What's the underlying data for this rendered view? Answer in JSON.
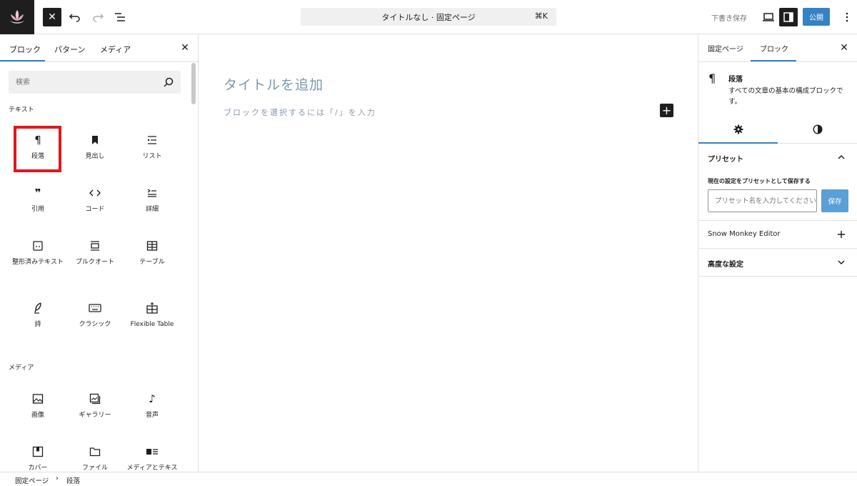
{
  "topbar": {
    "document_title": "タイトルなし · 固定ページ",
    "shortcut": "⌘K",
    "draft_label": "下書き保存",
    "publish_label": "公開"
  },
  "inserter": {
    "tabs": [
      "ブロック",
      "パターン",
      "メディア"
    ],
    "search_placeholder": "検索",
    "categories": {
      "text": {
        "label": "テキスト",
        "blocks": [
          "段落",
          "見出し",
          "リスト",
          "引用",
          "コード",
          "詳細",
          "整形済みテキスト",
          "プルクオート",
          "テーブル",
          "詩",
          "クラシック",
          "Flexible Table"
        ]
      },
      "media": {
        "label": "メディア",
        "blocks": [
          "画像",
          "ギャラリー",
          "音声",
          "カバー",
          "ファイル",
          "メディアとテキスト"
        ]
      }
    }
  },
  "canvas": {
    "title_placeholder": "タイトルを追加",
    "paragraph_placeholder": "ブロックを選択するには「/」を入力"
  },
  "sidebar": {
    "tabs": [
      "固定ページ",
      "ブロック"
    ],
    "block_card": {
      "title": "段落",
      "description": "すべての文章の基本の構成ブロックです。"
    },
    "preset": {
      "title": "プリセット",
      "save_label": "現在の設定をプリセットとして保存する",
      "input_placeholder": "プリセット名を入力してください",
      "save_button": "保存"
    },
    "snow_monkey_title": "Snow Monkey Editor",
    "advanced_title": "高度な設定"
  },
  "breadcrumb": [
    "固定ページ",
    "段落"
  ],
  "colors": {
    "accent": "#3582c4",
    "highlight": "#e3161b",
    "dark": "#1e1e1e"
  }
}
